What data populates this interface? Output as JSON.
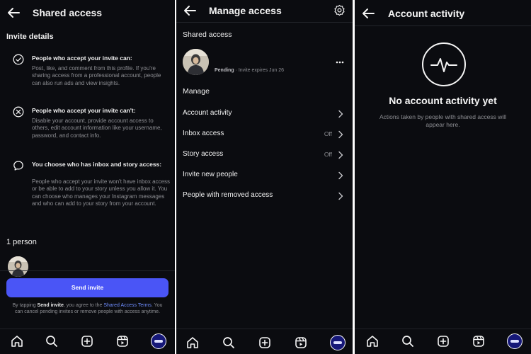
{
  "screen1": {
    "title": "Shared access",
    "invite_details_heading": "Invite details",
    "items": [
      {
        "icon": "check-circle-icon",
        "title": "People who accept your invite can:",
        "body": "Post, like, and comment from this profile. If you're sharing access from a professional account, people can also run ads and view insights."
      },
      {
        "icon": "x-circle-icon",
        "title": "People who accept your invite can't:",
        "body": "Disable your account, provide account access to others, edit account information like your username, password, and contact info."
      },
      {
        "icon": "message-bubble-icon",
        "title": "You choose who has inbox and story access:",
        "body": "People who accept your invite won't have inbox access or be able to add to your story unless you allow it. You can choose who manages your Instagram messages and who can add to your story from your account."
      }
    ],
    "people_count": "1 person",
    "send_button": "Send invite",
    "terms": {
      "prefix": "By tapping ",
      "bold": "Send invite",
      "middle": ", you agree to the ",
      "link": "Shared Access Terms",
      "suffix": ". You can cancel pending invites or remove people with access anytime."
    }
  },
  "screen2": {
    "title": "Manage access",
    "shared_access_heading": "Shared access",
    "pending_status": "Pending",
    "invite_expiry": " · Invite expires Jun 26",
    "manage_heading": "Manage",
    "rows": [
      {
        "label": "Account activity",
        "value": ""
      },
      {
        "label": "Inbox access",
        "value": "Off"
      },
      {
        "label": "Story access",
        "value": "Off"
      },
      {
        "label": "Invite new people",
        "value": ""
      },
      {
        "label": "People with removed access",
        "value": ""
      }
    ]
  },
  "screen3": {
    "title": "Account activity",
    "empty_title": "No account activity yet",
    "empty_body": "Actions taken by people with shared access will appear here."
  },
  "bottom_nav": {
    "icons": [
      "home-icon",
      "search-icon",
      "create-icon",
      "reels-icon",
      "profile-avatar"
    ]
  },
  "colors": {
    "background": "#0b0c10",
    "accent": "#4a55f6",
    "link": "#6f8dff",
    "muted_text": "#8e8f94"
  }
}
